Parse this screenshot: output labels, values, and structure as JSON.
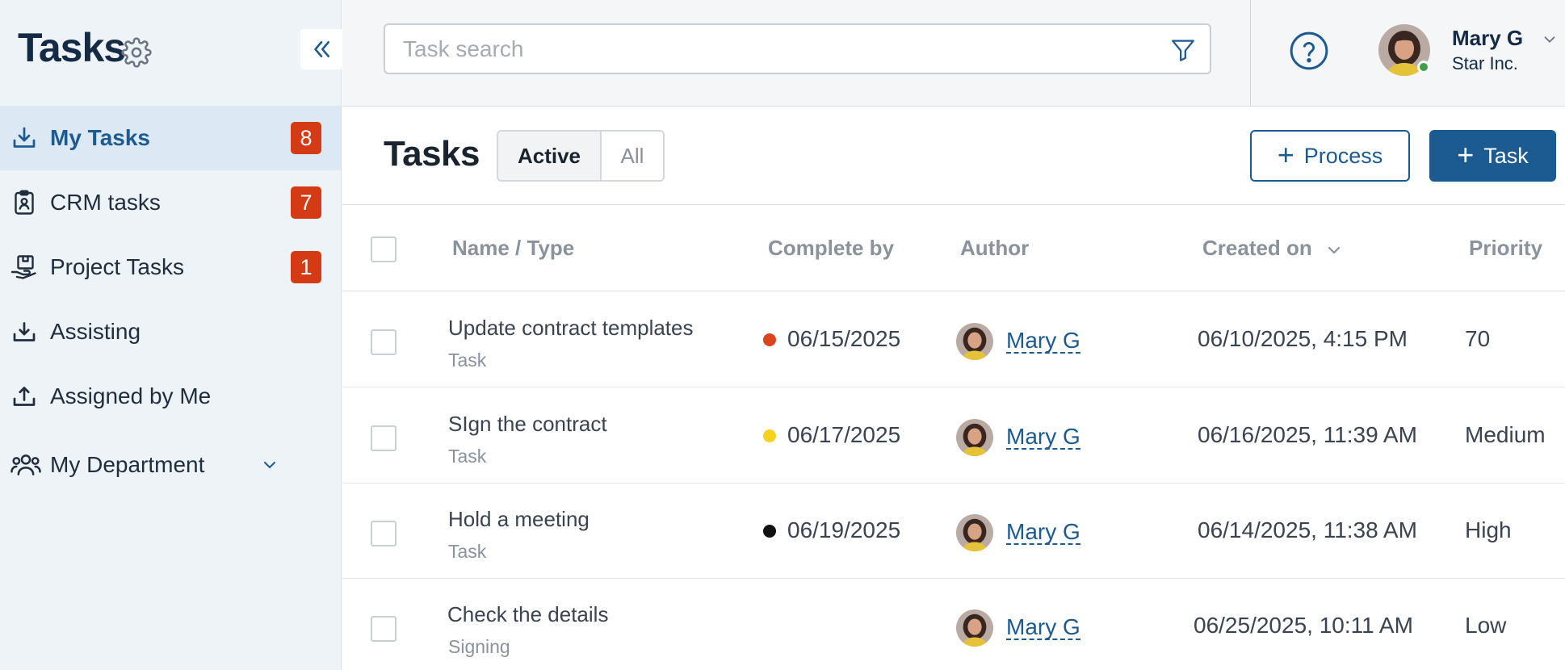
{
  "sidebar": {
    "title": "Tasks",
    "items": [
      {
        "label": "My Tasks",
        "badge": "8",
        "icon": "inbox-download-icon"
      },
      {
        "label": "CRM tasks",
        "badge": "7",
        "icon": "clipboard-user-icon"
      },
      {
        "label": "Project Tasks",
        "badge": "1",
        "icon": "hand-box-icon"
      },
      {
        "label": "Assisting",
        "badge": "",
        "icon": "tray-in-icon"
      },
      {
        "label": "Assigned by Me",
        "badge": "",
        "icon": "upload-icon"
      },
      {
        "label": "My Department",
        "badge": "",
        "icon": "people-icon"
      }
    ]
  },
  "topbar": {
    "search_placeholder": "Task search",
    "user_name": "Mary G",
    "user_company": "Star Inc."
  },
  "header": {
    "title": "Tasks",
    "tab_active": "Active",
    "tab_all": "All",
    "process_label": "Process",
    "task_label": "Task"
  },
  "table": {
    "columns": [
      "Name / Type",
      "Complete by",
      "Author",
      "Created on",
      "Priority"
    ],
    "rows": [
      {
        "name": "Update contract templates",
        "type": "Task",
        "due": "06/15/2025",
        "due_color": "#d9451c",
        "author": "Mary G",
        "created": "06/10/2025, 4:15 PM",
        "priority": "70"
      },
      {
        "name": "SIgn the contract",
        "type": "Task",
        "due": "06/17/2025",
        "due_color": "#f4d21f",
        "author": "Mary G",
        "created": "06/16/2025, 11:39 AM",
        "priority": "Medium"
      },
      {
        "name": "Hold a meeting",
        "type": "Task",
        "due": "06/19/2025",
        "due_color": "#111111",
        "author": "Mary G",
        "created": "06/14/2025, 11:38 AM",
        "priority": "High"
      },
      {
        "name": "Check the details",
        "type": "Signing",
        "due": "",
        "due_color": "",
        "author": "Mary G",
        "created": "06/25/2025, 10:11 AM",
        "priority": "Low"
      }
    ]
  },
  "colors": {
    "accent": "#1c5a92",
    "badge": "#d43a14",
    "sidebar_bg": "#eef3f8",
    "sidebar_active_bg": "#dce8f3"
  }
}
